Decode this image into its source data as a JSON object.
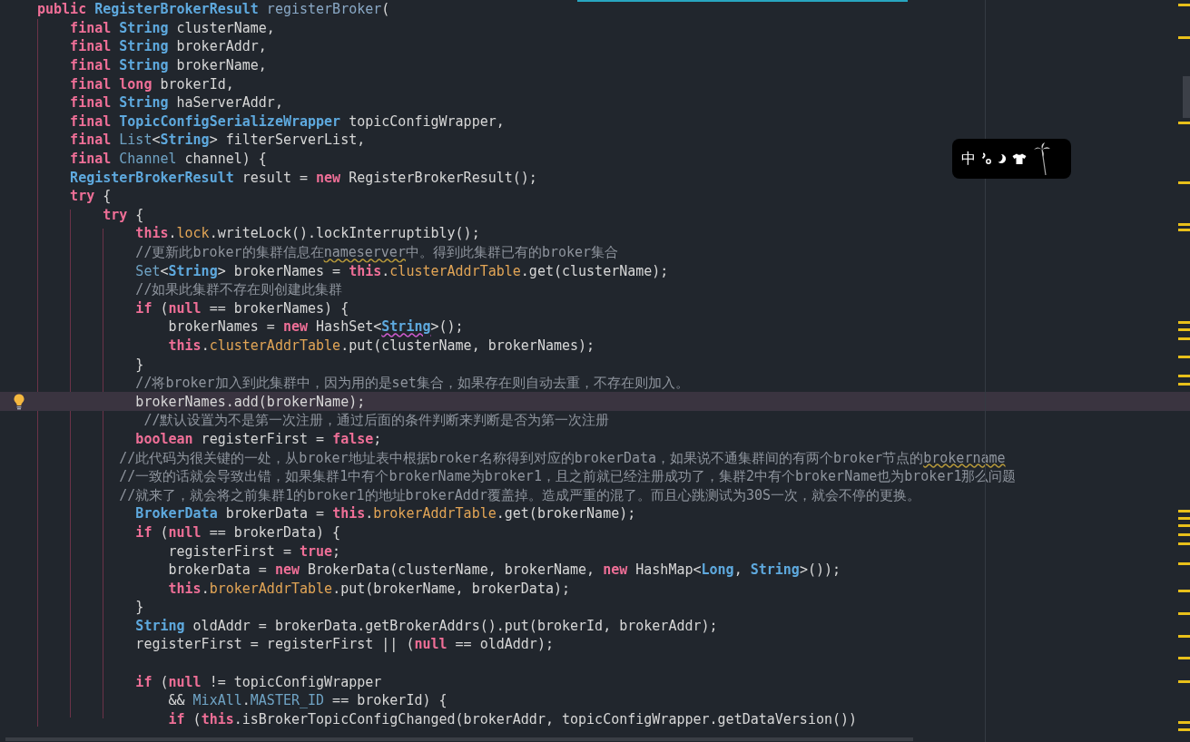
{
  "editor": {
    "lines": [
      {
        "current": false,
        "tokens": [
          {
            "kind": "keyword",
            "text": "public"
          },
          {
            "kind": "type",
            "text": " RegisterBrokerResult"
          },
          {
            "kind": "method",
            "text": " registerBroker"
          },
          {
            "kind": "plain",
            "text": "("
          }
        ]
      },
      {
        "current": false,
        "tokens": [
          {
            "kind": "keyword",
            "text": "    final"
          },
          {
            "kind": "type",
            "text": " String"
          },
          {
            "kind": "plain",
            "text": " clusterName,"
          }
        ]
      },
      {
        "current": false,
        "tokens": [
          {
            "kind": "keyword",
            "text": "    final"
          },
          {
            "kind": "type",
            "text": " String"
          },
          {
            "kind": "plain",
            "text": " brokerAddr,"
          }
        ]
      },
      {
        "current": false,
        "tokens": [
          {
            "kind": "keyword",
            "text": "    final"
          },
          {
            "kind": "type",
            "text": " String"
          },
          {
            "kind": "plain",
            "text": " brokerName,"
          }
        ]
      },
      {
        "current": false,
        "tokens": [
          {
            "kind": "keyword",
            "text": "    final"
          },
          {
            "kind": "keyword",
            "text": " long"
          },
          {
            "kind": "plain",
            "text": " brokerId,"
          }
        ]
      },
      {
        "current": false,
        "tokens": [
          {
            "kind": "keyword",
            "text": "    final"
          },
          {
            "kind": "type",
            "text": " String"
          },
          {
            "kind": "plain",
            "text": " haServerAddr,"
          }
        ]
      },
      {
        "current": false,
        "tokens": [
          {
            "kind": "keyword",
            "text": "    final"
          },
          {
            "kind": "type",
            "text": " TopicConfigSerializeWrapper"
          },
          {
            "kind": "plain",
            "text": " topicConfigWrapper,"
          }
        ]
      },
      {
        "current": false,
        "tokens": [
          {
            "kind": "keyword",
            "text": "    final"
          },
          {
            "kind": "class",
            "text": " List"
          },
          {
            "kind": "plain",
            "text": "<"
          },
          {
            "kind": "type",
            "text": "String"
          },
          {
            "kind": "plain",
            "text": "> filterServerList,"
          }
        ]
      },
      {
        "current": false,
        "tokens": [
          {
            "kind": "keyword",
            "text": "    final"
          },
          {
            "kind": "class",
            "text": " Channel"
          },
          {
            "kind": "plain",
            "text": " channel) {"
          }
        ]
      },
      {
        "current": false,
        "tokens": [
          {
            "kind": "type",
            "text": "    RegisterBrokerResult"
          },
          {
            "kind": "plain",
            "text": " result = "
          },
          {
            "kind": "keyword",
            "text": "new"
          },
          {
            "kind": "plain",
            "text": " RegisterBrokerResult();"
          }
        ]
      },
      {
        "current": false,
        "tokens": [
          {
            "kind": "keyword",
            "text": "    try"
          },
          {
            "kind": "plain",
            "text": " {"
          }
        ]
      },
      {
        "current": false,
        "tokens": [
          {
            "kind": "keyword",
            "text": "        try"
          },
          {
            "kind": "plain",
            "text": " {"
          }
        ]
      },
      {
        "current": false,
        "tokens": [
          {
            "kind": "keyword",
            "text": "            this"
          },
          {
            "kind": "plain",
            "text": "."
          },
          {
            "kind": "field",
            "text": "lock"
          },
          {
            "kind": "plain",
            "text": ".writeLock().lockInterruptibly();"
          }
        ]
      },
      {
        "current": false,
        "tokens": [
          {
            "kind": "comment",
            "text": "            //更新此broker的集群信息在"
          },
          {
            "kind": "comment_warn",
            "text": "nameserver"
          },
          {
            "kind": "comment",
            "text": "中。得到此集群已有的broker集合"
          }
        ]
      },
      {
        "current": false,
        "tokens": [
          {
            "kind": "class",
            "text": "            Set"
          },
          {
            "kind": "plain",
            "text": "<"
          },
          {
            "kind": "type",
            "text": "String"
          },
          {
            "kind": "plain",
            "text": "> brokerNames = "
          },
          {
            "kind": "keyword",
            "text": "this"
          },
          {
            "kind": "plain",
            "text": "."
          },
          {
            "kind": "field",
            "text": "clusterAddrTable"
          },
          {
            "kind": "plain",
            "text": ".get(clusterName);"
          }
        ]
      },
      {
        "current": false,
        "tokens": [
          {
            "kind": "comment",
            "text": "            //如果此集群不存在则创建此集群"
          }
        ]
      },
      {
        "current": false,
        "tokens": [
          {
            "kind": "keyword",
            "text": "            if"
          },
          {
            "kind": "plain",
            "text": " ("
          },
          {
            "kind": "keyword",
            "text": "null"
          },
          {
            "kind": "plain",
            "text": " == brokerNames) {"
          }
        ]
      },
      {
        "current": false,
        "tokens": [
          {
            "kind": "plain",
            "text": "                brokerNames = "
          },
          {
            "kind": "keyword",
            "text": "new"
          },
          {
            "kind": "plain",
            "text": " HashSet<"
          },
          {
            "kind": "type_warn",
            "text": "String"
          },
          {
            "kind": "plain",
            "text": ">();"
          }
        ]
      },
      {
        "current": false,
        "tokens": [
          {
            "kind": "keyword",
            "text": "                this"
          },
          {
            "kind": "plain",
            "text": "."
          },
          {
            "kind": "field",
            "text": "clusterAddrTable"
          },
          {
            "kind": "plain",
            "text": ".put(clusterName, brokerNames);"
          }
        ]
      },
      {
        "current": false,
        "tokens": [
          {
            "kind": "plain",
            "text": "            }"
          }
        ]
      },
      {
        "current": false,
        "tokens": [
          {
            "kind": "comment",
            "text": "            //将broker加入到此集群中，因为用的是set集合，如果存在则自动去重，不存在则加入。"
          }
        ]
      },
      {
        "current": true,
        "tokens": [
          {
            "kind": "plain",
            "text": "            brokerNames.add(brokerName);"
          }
        ]
      },
      {
        "current": false,
        "tokens": [
          {
            "kind": "comment",
            "text": "             //默认设置为不是第一次注册，通过后面的条件判断来判断是否为第一次注册"
          }
        ]
      },
      {
        "current": false,
        "tokens": [
          {
            "kind": "keyword",
            "text": "            boolean"
          },
          {
            "kind": "plain",
            "text": " registerFirst = "
          },
          {
            "kind": "keyword",
            "text": "false"
          },
          {
            "kind": "plain",
            "text": ";"
          }
        ]
      },
      {
        "current": false,
        "tokens": [
          {
            "kind": "comment",
            "text": "          //此代码为很关键的一处，从broker地址表中根据broker名称得到对应的brokerData，如果说不通集群间的有两个broker节点的"
          },
          {
            "kind": "comment_warn",
            "text": "brokername"
          }
        ]
      },
      {
        "current": false,
        "tokens": [
          {
            "kind": "comment",
            "text": "          //一致的话就会导致出错，如果集群1中有个brokerName为broker1，且之前就已经注册成功了，集群2中有个brokerName也为broker1那么问题"
          }
        ]
      },
      {
        "current": false,
        "tokens": [
          {
            "kind": "comment",
            "text": "          //就来了，就会将之前集群1的broker1的地址brokerAddr覆盖掉。造成严重的混了。而且心跳测试为30S一次，就会不停的更换。"
          }
        ]
      },
      {
        "current": false,
        "tokens": [
          {
            "kind": "type",
            "text": "            BrokerData"
          },
          {
            "kind": "plain",
            "text": " brokerData = "
          },
          {
            "kind": "keyword",
            "text": "this"
          },
          {
            "kind": "plain",
            "text": "."
          },
          {
            "kind": "field",
            "text": "brokerAddrTable"
          },
          {
            "kind": "plain",
            "text": ".get(brokerName);"
          }
        ]
      },
      {
        "current": false,
        "tokens": [
          {
            "kind": "keyword",
            "text": "            if"
          },
          {
            "kind": "plain",
            "text": " ("
          },
          {
            "kind": "keyword",
            "text": "null"
          },
          {
            "kind": "plain",
            "text": " == brokerData) {"
          }
        ]
      },
      {
        "current": false,
        "tokens": [
          {
            "kind": "plain",
            "text": "                registerFirst = "
          },
          {
            "kind": "keyword",
            "text": "true"
          },
          {
            "kind": "plain",
            "text": ";"
          }
        ]
      },
      {
        "current": false,
        "tokens": [
          {
            "kind": "plain",
            "text": "                brokerData = "
          },
          {
            "kind": "keyword",
            "text": "new"
          },
          {
            "kind": "plain",
            "text": " BrokerData(clusterName, brokerName, "
          },
          {
            "kind": "keyword",
            "text": "new"
          },
          {
            "kind": "plain",
            "text": " HashMap<"
          },
          {
            "kind": "type",
            "text": "Long"
          },
          {
            "kind": "plain",
            "text": ", "
          },
          {
            "kind": "type",
            "text": "String"
          },
          {
            "kind": "plain",
            "text": ">());"
          }
        ]
      },
      {
        "current": false,
        "tokens": [
          {
            "kind": "keyword",
            "text": "                this"
          },
          {
            "kind": "plain",
            "text": "."
          },
          {
            "kind": "field",
            "text": "brokerAddrTable"
          },
          {
            "kind": "plain",
            "text": ".put(brokerName, brokerData);"
          }
        ]
      },
      {
        "current": false,
        "tokens": [
          {
            "kind": "plain",
            "text": "            }"
          }
        ]
      },
      {
        "current": false,
        "tokens": [
          {
            "kind": "type",
            "text": "            String"
          },
          {
            "kind": "plain",
            "text": " oldAddr = brokerData.getBrokerAddrs().put(brokerId, brokerAddr);"
          }
        ]
      },
      {
        "current": false,
        "tokens": [
          {
            "kind": "plain",
            "text": "            registerFirst = registerFirst || ("
          },
          {
            "kind": "keyword",
            "text": "null"
          },
          {
            "kind": "plain",
            "text": " == oldAddr);"
          }
        ]
      },
      {
        "current": false
      },
      {
        "current": false,
        "tokens": [
          {
            "kind": "keyword",
            "text": "            if"
          },
          {
            "kind": "plain",
            "text": " ("
          },
          {
            "kind": "keyword",
            "text": "null"
          },
          {
            "kind": "plain",
            "text": " != topicConfigWrapper"
          }
        ]
      },
      {
        "current": false,
        "tokens": [
          {
            "kind": "plain",
            "text": "                && "
          },
          {
            "kind": "class",
            "text": "MixAll"
          },
          {
            "kind": "plain",
            "text": "."
          },
          {
            "kind": "class",
            "text": "MASTER_ID"
          },
          {
            "kind": "plain",
            "text": " == brokerId) {"
          }
        ]
      },
      {
        "current": false,
        "tokens": [
          {
            "kind": "keyword",
            "text": "                if"
          },
          {
            "kind": "plain",
            "text": " ("
          },
          {
            "kind": "keyword",
            "text": "this"
          },
          {
            "kind": "plain",
            "text": ".isBrokerTopicConfigChanged(brokerAddr, topicConfigWrapper.getDataVersion())"
          }
        ]
      }
    ]
  },
  "ime_toolbar": {
    "mode": "中"
  }
}
